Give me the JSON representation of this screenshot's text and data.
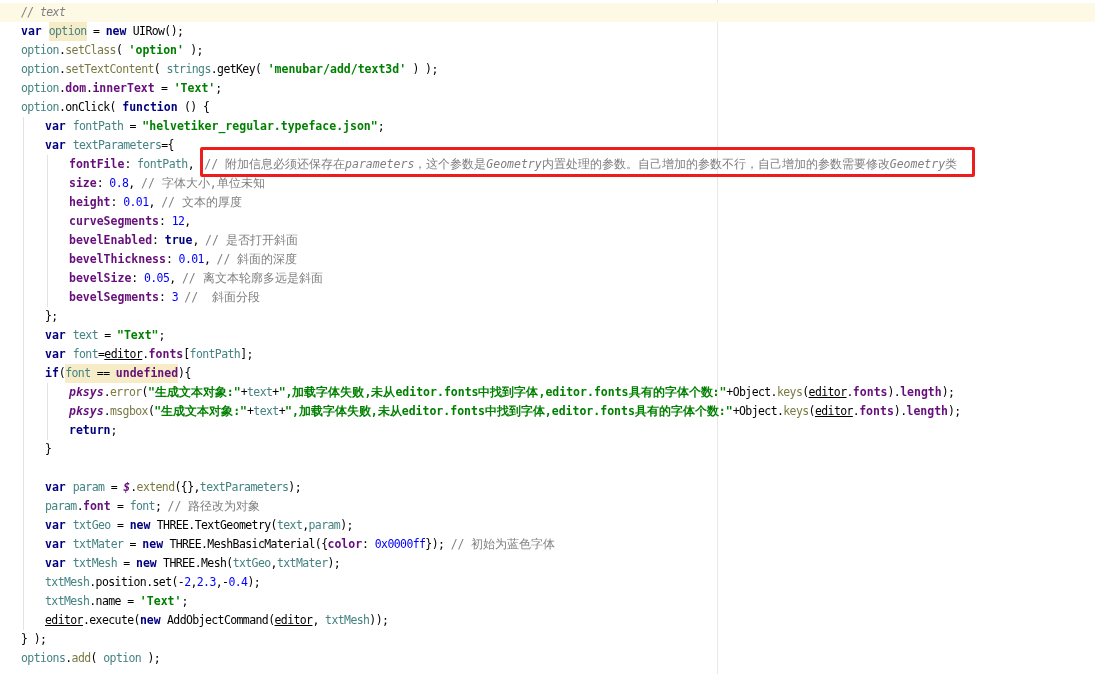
{
  "editor": {
    "lines": [
      {
        "current": true,
        "tokens": [
          {
            "text": "// text",
            "kind": "comment"
          }
        ]
      },
      {
        "current": false,
        "tokens": [
          {
            "text": "var ",
            "kind": "keyword"
          },
          {
            "kind": "highlight",
            "children": [
              {
                "text": "option",
                "kind": "local"
              }
            ]
          },
          {
            "text": " = ",
            "kind": "plain"
          },
          {
            "text": "new",
            "kind": "keyword"
          },
          {
            "text": " UIRow();",
            "kind": "plain"
          }
        ]
      },
      {
        "current": false,
        "tokens": [
          {
            "text": "option",
            "kind": "local"
          },
          {
            "text": ".",
            "kind": "plain"
          },
          {
            "text": "setClass",
            "kind": "method"
          },
          {
            "text": "( ",
            "kind": "plain"
          },
          {
            "text": "'option'",
            "kind": "string"
          },
          {
            "text": " );",
            "kind": "plain"
          }
        ]
      },
      {
        "current": false,
        "tokens": [
          {
            "text": "option",
            "kind": "local"
          },
          {
            "text": ".",
            "kind": "plain"
          },
          {
            "text": "setTextContent",
            "kind": "method"
          },
          {
            "text": "( ",
            "kind": "plain"
          },
          {
            "text": "strings",
            "kind": "local"
          },
          {
            "text": ".getKey( ",
            "kind": "plain"
          },
          {
            "text": "'menubar/add/text3d'",
            "kind": "string"
          },
          {
            "text": " ) );",
            "kind": "plain"
          }
        ]
      },
      {
        "current": false,
        "tokens": [
          {
            "text": "option",
            "kind": "local"
          },
          {
            "text": ".",
            "kind": "plain"
          },
          {
            "text": "dom",
            "kind": "field"
          },
          {
            "text": ".",
            "kind": "plain"
          },
          {
            "text": "innerText",
            "kind": "field"
          },
          {
            "text": " = ",
            "kind": "plain"
          },
          {
            "text": "'Text'",
            "kind": "string"
          },
          {
            "text": ";",
            "kind": "plain"
          }
        ]
      },
      {
        "current": false,
        "tokens": [
          {
            "text": "option",
            "kind": "local"
          },
          {
            "text": ".onClick( ",
            "kind": "plain"
          },
          {
            "text": "function",
            "kind": "keyword"
          },
          {
            "text": " () {",
            "kind": "plain"
          }
        ],
        "children": [
          {
            "current": false,
            "tokens": [
              {
                "text": "var ",
                "kind": "keyword"
              },
              {
                "text": "fontPath",
                "kind": "local"
              },
              {
                "text": " = ",
                "kind": "plain"
              },
              {
                "text": "\"helvetiker_regular.typeface.json\"",
                "kind": "string"
              },
              {
                "text": ";",
                "kind": "plain"
              }
            ]
          },
          {
            "current": false,
            "tokens": [
              {
                "text": "var ",
                "kind": "keyword"
              },
              {
                "text": "textParameters",
                "kind": "local"
              },
              {
                "text": "={",
                "kind": "plain"
              }
            ],
            "children": [
              {
                "current": false,
                "tokens": [
                  {
                    "text": "fontFile",
                    "kind": "field"
                  },
                  {
                    "text": ": ",
                    "kind": "plain"
                  },
                  {
                    "text": "fontPath",
                    "kind": "local"
                  },
                  {
                    "text": ", ",
                    "kind": "plain"
                  },
                  {
                    "kind": "annotation",
                    "children": [
                      {
                        "text": "// 附加信息必须还保存在",
                        "kind": "note"
                      },
                      {
                        "text": "parameters",
                        "kind": "comment"
                      },
                      {
                        "text": "，这个参数是",
                        "kind": "note"
                      },
                      {
                        "text": "Geometry",
                        "kind": "comment"
                      },
                      {
                        "text": "内置处理的参数。自己增加的参数不行，自己增加的参数需要修改",
                        "kind": "note"
                      },
                      {
                        "text": "Geometry",
                        "kind": "comment"
                      },
                      {
                        "text": "类",
                        "kind": "note"
                      }
                    ]
                  }
                ]
              },
              {
                "current": false,
                "tokens": [
                  {
                    "text": "size",
                    "kind": "field"
                  },
                  {
                    "text": ": ",
                    "kind": "plain"
                  },
                  {
                    "text": "0.8",
                    "kind": "number"
                  },
                  {
                    "text": ", ",
                    "kind": "plain"
                  },
                  {
                    "text": "// 字体大小,单位未知",
                    "kind": "note"
                  }
                ]
              },
              {
                "current": false,
                "tokens": [
                  {
                    "text": "height",
                    "kind": "field"
                  },
                  {
                    "text": ": ",
                    "kind": "plain"
                  },
                  {
                    "text": "0.01",
                    "kind": "number"
                  },
                  {
                    "text": ", ",
                    "kind": "plain"
                  },
                  {
                    "text": "// 文本的厚度",
                    "kind": "note"
                  }
                ]
              },
              {
                "current": false,
                "tokens": [
                  {
                    "text": "curveSegments",
                    "kind": "field"
                  },
                  {
                    "text": ": ",
                    "kind": "plain"
                  },
                  {
                    "text": "12",
                    "kind": "number"
                  },
                  {
                    "text": ",",
                    "kind": "plain"
                  }
                ]
              },
              {
                "current": false,
                "tokens": [
                  {
                    "text": "bevelEnabled",
                    "kind": "field"
                  },
                  {
                    "text": ": ",
                    "kind": "plain"
                  },
                  {
                    "text": "true",
                    "kind": "keyword"
                  },
                  {
                    "text": ", ",
                    "kind": "plain"
                  },
                  {
                    "text": "// 是否打开斜面",
                    "kind": "note"
                  }
                ]
              },
              {
                "current": false,
                "tokens": [
                  {
                    "text": "bevelThickness",
                    "kind": "field"
                  },
                  {
                    "text": ": ",
                    "kind": "plain"
                  },
                  {
                    "text": "0.01",
                    "kind": "number"
                  },
                  {
                    "text": ", ",
                    "kind": "plain"
                  },
                  {
                    "text": "// 斜面的深度",
                    "kind": "note"
                  }
                ]
              },
              {
                "current": false,
                "tokens": [
                  {
                    "text": "bevelSize",
                    "kind": "field"
                  },
                  {
                    "text": ": ",
                    "kind": "plain"
                  },
                  {
                    "text": "0.05",
                    "kind": "number"
                  },
                  {
                    "text": ", ",
                    "kind": "plain"
                  },
                  {
                    "text": "// 离文本轮廓多远是斜面",
                    "kind": "note"
                  }
                ]
              },
              {
                "current": false,
                "tokens": [
                  {
                    "text": "bevelSegments",
                    "kind": "field"
                  },
                  {
                    "text": ": ",
                    "kind": "plain"
                  },
                  {
                    "text": "3 ",
                    "kind": "number"
                  },
                  {
                    "text": "//  斜面分段",
                    "kind": "note"
                  }
                ]
              }
            ]
          },
          {
            "current": false,
            "tokens": [
              {
                "text": "};",
                "kind": "plain"
              }
            ]
          },
          {
            "current": false,
            "tokens": [
              {
                "text": "var ",
                "kind": "keyword"
              },
              {
                "text": "text",
                "kind": "local"
              },
              {
                "text": " = ",
                "kind": "plain"
              },
              {
                "text": "\"Text\"",
                "kind": "string"
              },
              {
                "text": ";",
                "kind": "plain"
              }
            ]
          },
          {
            "current": false,
            "tokens": [
              {
                "text": "var ",
                "kind": "keyword"
              },
              {
                "text": "font",
                "kind": "local"
              },
              {
                "text": "=",
                "kind": "plain"
              },
              {
                "text": "editor",
                "kind": "global_var"
              },
              {
                "text": ".",
                "kind": "plain"
              },
              {
                "text": "fonts",
                "kind": "field"
              },
              {
                "text": "[",
                "kind": "plain"
              },
              {
                "text": "fontPath",
                "kind": "local"
              },
              {
                "text": "];",
                "kind": "plain"
              }
            ]
          },
          {
            "current": false,
            "tokens": [
              {
                "text": "if",
                "kind": "keyword"
              },
              {
                "text": "(",
                "kind": "plain"
              },
              {
                "kind": "highlight",
                "children": [
                  {
                    "text": "font",
                    "kind": "local"
                  },
                  {
                    "text": " == ",
                    "kind": "plain"
                  },
                  {
                    "text": "undefined",
                    "kind": "field"
                  }
                ]
              },
              {
                "text": "){",
                "kind": "plain"
              }
            ],
            "children": [
              {
                "current": false,
                "tokens": [
                  {
                    "text": "pksys",
                    "kind": "global"
                  },
                  {
                    "text": ".",
                    "kind": "plain"
                  },
                  {
                    "text": "error",
                    "kind": "method"
                  },
                  {
                    "text": "(",
                    "kind": "plain"
                  },
                  {
                    "text": "\"生成文本对象:\"",
                    "kind": "string"
                  },
                  {
                    "text": "+",
                    "kind": "plain"
                  },
                  {
                    "text": "text",
                    "kind": "local"
                  },
                  {
                    "text": "+",
                    "kind": "plain"
                  },
                  {
                    "text": "\",加载字体失败,未从editor.fonts中找到字体,editor.fonts具有的字体个数:\"",
                    "kind": "string"
                  },
                  {
                    "text": "+Object.",
                    "kind": "plain"
                  },
                  {
                    "text": "keys",
                    "kind": "method"
                  },
                  {
                    "text": "(",
                    "kind": "plain"
                  },
                  {
                    "text": "editor",
                    "kind": "global_var"
                  },
                  {
                    "text": ".",
                    "kind": "plain"
                  },
                  {
                    "text": "fonts",
                    "kind": "field"
                  },
                  {
                    "text": ").",
                    "kind": "plain"
                  },
                  {
                    "text": "length",
                    "kind": "field"
                  },
                  {
                    "text": ");",
                    "kind": "plain"
                  }
                ]
              },
              {
                "current": false,
                "tokens": [
                  {
                    "text": "pksys",
                    "kind": "global"
                  },
                  {
                    "text": ".",
                    "kind": "plain"
                  },
                  {
                    "text": "msgbox",
                    "kind": "method"
                  },
                  {
                    "text": "(",
                    "kind": "plain"
                  },
                  {
                    "text": "\"生成文本对象:\"",
                    "kind": "string"
                  },
                  {
                    "text": "+",
                    "kind": "plain"
                  },
                  {
                    "text": "text",
                    "kind": "local"
                  },
                  {
                    "text": "+",
                    "kind": "plain"
                  },
                  {
                    "text": "\",加载字体失败,未从editor.fonts中找到字体,editor.fonts具有的字体个数:\"",
                    "kind": "string"
                  },
                  {
                    "text": "+Object.",
                    "kind": "plain"
                  },
                  {
                    "text": "keys",
                    "kind": "method"
                  },
                  {
                    "text": "(",
                    "kind": "plain"
                  },
                  {
                    "text": "editor",
                    "kind": "global_var"
                  },
                  {
                    "text": ".",
                    "kind": "plain"
                  },
                  {
                    "text": "fonts",
                    "kind": "field"
                  },
                  {
                    "text": ").",
                    "kind": "plain"
                  },
                  {
                    "text": "length",
                    "kind": "field"
                  },
                  {
                    "text": ");",
                    "kind": "plain"
                  }
                ]
              },
              {
                "current": false,
                "tokens": [
                  {
                    "text": "return",
                    "kind": "keyword"
                  },
                  {
                    "text": ";",
                    "kind": "plain"
                  }
                ]
              }
            ]
          },
          {
            "current": false,
            "tokens": [
              {
                "text": "}",
                "kind": "plain"
              }
            ]
          },
          {
            "current": false
          },
          {
            "current": false,
            "tokens": [
              {
                "text": "var ",
                "kind": "keyword"
              },
              {
                "text": "param",
                "kind": "local"
              },
              {
                "text": " = ",
                "kind": "plain"
              },
              {
                "text": "$",
                "kind": "global"
              },
              {
                "text": ".",
                "kind": "plain"
              },
              {
                "text": "extend",
                "kind": "method"
              },
              {
                "text": "({},",
                "kind": "plain"
              },
              {
                "text": "textParameters",
                "kind": "local"
              },
              {
                "text": ");",
                "kind": "plain"
              }
            ]
          },
          {
            "current": false,
            "tokens": [
              {
                "text": "param",
                "kind": "local"
              },
              {
                "text": ".",
                "kind": "plain"
              },
              {
                "text": "font",
                "kind": "field"
              },
              {
                "text": " = ",
                "kind": "plain"
              },
              {
                "text": "font",
                "kind": "local"
              },
              {
                "text": "; ",
                "kind": "plain"
              },
              {
                "text": "// 路径改为对象",
                "kind": "note"
              }
            ]
          },
          {
            "current": false,
            "tokens": [
              {
                "text": "var ",
                "kind": "keyword"
              },
              {
                "text": "txtGeo",
                "kind": "local"
              },
              {
                "text": " = ",
                "kind": "plain"
              },
              {
                "text": "new",
                "kind": "keyword"
              },
              {
                "text": " THREE.TextGeometry(",
                "kind": "plain"
              },
              {
                "text": "text",
                "kind": "local"
              },
              {
                "text": ",",
                "kind": "plain"
              },
              {
                "text": "param",
                "kind": "local"
              },
              {
                "text": ");",
                "kind": "plain"
              }
            ]
          },
          {
            "current": false,
            "tokens": [
              {
                "text": "var ",
                "kind": "keyword"
              },
              {
                "text": "txtMater",
                "kind": "local"
              },
              {
                "text": " = ",
                "kind": "plain"
              },
              {
                "text": "new",
                "kind": "keyword"
              },
              {
                "text": " THREE.MeshBasicMaterial({",
                "kind": "plain"
              },
              {
                "text": "color",
                "kind": "field"
              },
              {
                "text": ": ",
                "kind": "plain"
              },
              {
                "text": "0x0000ff",
                "kind": "number"
              },
              {
                "text": "}); ",
                "kind": "plain"
              },
              {
                "text": "// 初始为蓝色字体",
                "kind": "note"
              }
            ]
          },
          {
            "current": false,
            "tokens": [
              {
                "text": "var ",
                "kind": "keyword"
              },
              {
                "text": "txtMesh",
                "kind": "local"
              },
              {
                "text": " = ",
                "kind": "plain"
              },
              {
                "text": "new",
                "kind": "keyword"
              },
              {
                "text": " THREE.Mesh(",
                "kind": "plain"
              },
              {
                "text": "txtGeo",
                "kind": "local"
              },
              {
                "text": ",",
                "kind": "plain"
              },
              {
                "text": "txtMater",
                "kind": "local"
              },
              {
                "text": ");",
                "kind": "plain"
              }
            ]
          },
          {
            "current": false,
            "tokens": [
              {
                "text": "txtMesh",
                "kind": "local"
              },
              {
                "text": ".position.set(-",
                "kind": "plain"
              },
              {
                "text": "2",
                "kind": "number"
              },
              {
                "text": ",",
                "kind": "plain"
              },
              {
                "text": "2.3",
                "kind": "number"
              },
              {
                "text": ",-",
                "kind": "plain"
              },
              {
                "text": "0.4",
                "kind": "number"
              },
              {
                "text": ");",
                "kind": "plain"
              }
            ]
          },
          {
            "current": false,
            "tokens": [
              {
                "text": "txtMesh",
                "kind": "local"
              },
              {
                "text": ".name = ",
                "kind": "plain"
              },
              {
                "text": "'Text'",
                "kind": "string"
              },
              {
                "text": ";",
                "kind": "plain"
              }
            ]
          },
          {
            "current": false,
            "tokens": [
              {
                "text": "editor",
                "kind": "global_var"
              },
              {
                "text": ".execute(",
                "kind": "plain"
              },
              {
                "text": "new",
                "kind": "keyword"
              },
              {
                "text": " AddObjectCommand(",
                "kind": "plain"
              },
              {
                "text": "editor",
                "kind": "global_var"
              },
              {
                "text": ", ",
                "kind": "plain"
              },
              {
                "text": "txtMesh",
                "kind": "local"
              },
              {
                "text": "));",
                "kind": "plain"
              }
            ]
          }
        ]
      },
      {
        "current": false,
        "tokens": [
          {
            "text": "} );",
            "kind": "plain"
          }
        ]
      },
      {
        "current": false,
        "tokens": [
          {
            "text": "options",
            "kind": "local"
          },
          {
            "text": ".",
            "kind": "plain"
          },
          {
            "text": "add",
            "kind": "method"
          },
          {
            "text": "( ",
            "kind": "plain"
          },
          {
            "text": "option",
            "kind": "local"
          },
          {
            "text": " );",
            "kind": "plain"
          }
        ]
      }
    ]
  }
}
